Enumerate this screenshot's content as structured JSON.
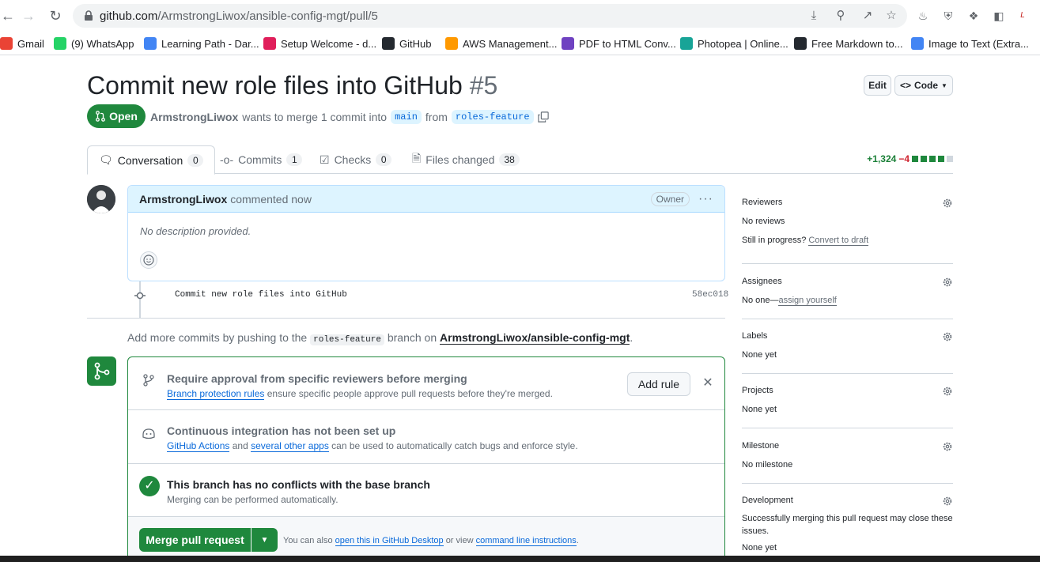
{
  "browser": {
    "url_host": "github.com",
    "url_path": "/ArmstrongLiwox/ansible-config-mgt/pull/5",
    "bookmarks": [
      {
        "label": "Gmail",
        "icon": "gmail-icon",
        "color": "#ea4335"
      },
      {
        "label": "(9) WhatsApp",
        "icon": "whatsapp-icon",
        "color": "#25d366"
      },
      {
        "label": "Learning Path - Dar...",
        "icon": "darey-icon",
        "color": "#4285f4"
      },
      {
        "label": "Setup Welcome - d...",
        "icon": "slack-icon",
        "color": "#e01e5a"
      },
      {
        "label": "GitHub",
        "icon": "github-icon",
        "color": "#24292f"
      },
      {
        "label": "AWS Management...",
        "icon": "aws-icon",
        "color": "#ff9900"
      },
      {
        "label": "PDF to HTML Conv...",
        "icon": "pdf-icon",
        "color": "#6f42c1"
      },
      {
        "label": "Photopea | Online...",
        "icon": "photopea-icon",
        "color": "#18a497"
      },
      {
        "label": "Free Markdown to...",
        "icon": "markdown-icon",
        "color": "#24292f"
      },
      {
        "label": "Image to Text (Extra...",
        "icon": "image-to-text-icon",
        "color": "#4285f4"
      }
    ]
  },
  "pr": {
    "title": "Commit new role files into GitHub",
    "number": "#5",
    "state": "Open",
    "author": "ArmstrongLiwox",
    "meta_text": "wants to merge 1 commit into",
    "base_branch": "main",
    "from_text": "from",
    "head_branch": "roles-feature",
    "edit_label": "Edit",
    "code_label": "Code"
  },
  "tabs": [
    {
      "label": "Conversation",
      "count": "0"
    },
    {
      "label": "Commits",
      "count": "1"
    },
    {
      "label": "Checks",
      "count": "0"
    },
    {
      "label": "Files changed",
      "count": "38"
    }
  ],
  "diffstat": {
    "additions": "+1,324",
    "deletions": "−4"
  },
  "comment": {
    "author": "ArmstrongLiwox",
    "action": "commented now",
    "badge": "Owner",
    "body": "No description provided."
  },
  "commit": {
    "message": "Commit new role files into GitHub",
    "sha": "58ec018"
  },
  "push_hint": {
    "prefix": "Add more commits by pushing to the",
    "branch": "roles-feature",
    "middle": "branch on",
    "repo": "ArmstrongLiwox/ansible-config-mgt",
    "suffix": "."
  },
  "merge": {
    "protection_title": "Require approval from specific reviewers before merging",
    "protection_link": "Branch protection rules",
    "protection_text": "ensure specific people approve pull requests before they're merged.",
    "add_rule": "Add rule",
    "ci_title": "Continuous integration has not been set up",
    "ci_link1": "GitHub Actions",
    "ci_and": "and",
    "ci_link2": "several other apps",
    "ci_text": "can be used to automatically catch bugs and enforce style.",
    "conflict_title": "This branch has no conflicts with the base branch",
    "conflict_sub": "Merging can be performed automatically.",
    "merge_button": "Merge pull request",
    "alt_prefix": "You can also",
    "alt_link1": "open this in GitHub Desktop",
    "alt_middle": "or view",
    "alt_link2": "command line instructions",
    "alt_suffix": "."
  },
  "sidebar": {
    "reviewers": {
      "title": "Reviewers",
      "value": "No reviews",
      "note": "Still in progress?",
      "link": "Convert to draft"
    },
    "assignees": {
      "title": "Assignees",
      "value": "No one—",
      "link": "assign yourself"
    },
    "labels": {
      "title": "Labels",
      "value": "None yet"
    },
    "projects": {
      "title": "Projects",
      "value": "None yet"
    },
    "milestone": {
      "title": "Milestone",
      "value": "No milestone"
    },
    "development": {
      "title": "Development",
      "value": "Successfully merging this pull request may close these issues.",
      "value2": "None yet"
    }
  },
  "colors": {
    "accent_green": "#1f883d",
    "link_blue": "#0969da",
    "header_blue": "#ddf4ff"
  }
}
